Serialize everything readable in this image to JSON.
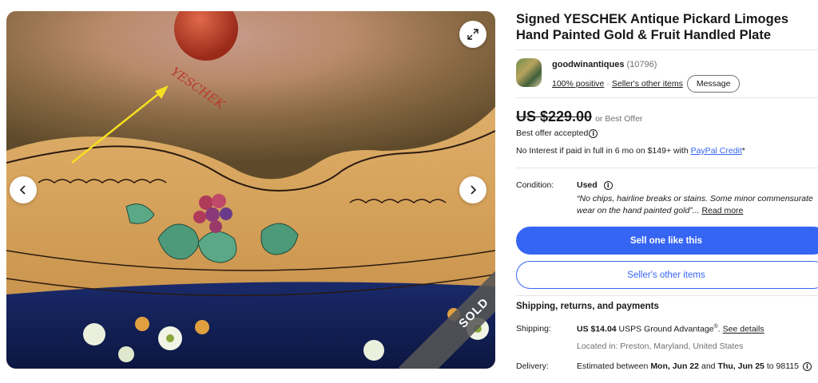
{
  "gallery": {
    "image_alt": "YESCHEK",
    "sold_badge": "SOLD",
    "expand_icon": "expand-icon",
    "prev_icon": "chevron-left-icon",
    "next_icon": "chevron-right-icon"
  },
  "item": {
    "title": "Signed YESCHEK Antique Pickard Limoges Hand Painted Gold & Fruit Handled Plate"
  },
  "seller": {
    "name": "goodwinantiques",
    "feedback_count": "(10796)",
    "positive": "100% positive",
    "separator": "·",
    "other_items_link": "Seller's other items",
    "message_button": "Message"
  },
  "pricing": {
    "price": "US $229.00",
    "best_offer": "or Best Offer",
    "accepted": "Best offer accepted",
    "interest_text": "No Interest if paid in full in 6 mo on $149+ with ",
    "paypal_link": "PayPal Credit",
    "asterisk": "*"
  },
  "condition": {
    "label": "Condition:",
    "value": "Used",
    "note_line1": "“No chips, hairline breaks or stains. Some minor commensurate",
    "note_line2": "wear on the hand painted gold”...",
    "read_more": "Read more"
  },
  "actions": {
    "sell_one": "Sell one like this",
    "other_items": "Seller's other items"
  },
  "shipping": {
    "heading": "Shipping, returns, and payments",
    "label": "Shipping:",
    "cost": "US $14.04",
    "service": " USPS Ground Advantage",
    "registered": "®",
    "period": ".",
    "see_details": "See details",
    "location": "Located in: Preston, Maryland, United States",
    "delivery_label": "Delivery:",
    "delivery_prefix": "Estimated between",
    "delivery_start": "Mon, Jun 22",
    "delivery_and": "and",
    "delivery_end": "Thu, Jun 25",
    "delivery_suffix": "to 98115"
  },
  "colors": {
    "accent": "#3665f3",
    "text": "#191919",
    "muted": "#707070"
  }
}
